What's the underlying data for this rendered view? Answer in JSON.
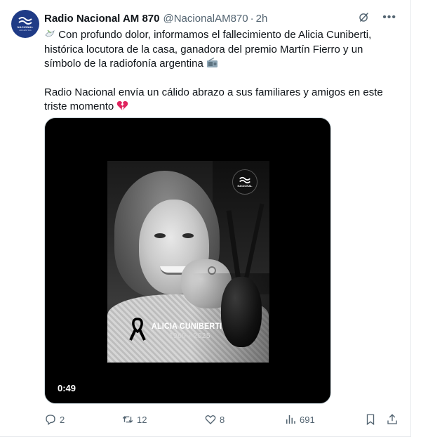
{
  "post": {
    "author_name": "Radio Nacional AM 870",
    "handle": "@NacionalAM870",
    "separator": "·",
    "time": "2h",
    "avatar_text": "NACIONAL",
    "avatar_sub": "ARGENTINA",
    "paragraph1": " Con profundo dolor, informamos el fallecimiento de Alicia Cuniberti, histórica locutora de la casa, ganadora del premio Martín Fierro y un símbolo de la radiofonía argentina ",
    "paragraph2": "Radio Nacional envía un cálido abrazo a sus familiares y amigos en este triste momento "
  },
  "media": {
    "logo_text": "NACIONAL",
    "overlay_name": "ALICIA CUNIBERTI",
    "overlay_years": "1960 - 2025",
    "duration": "0:49"
  },
  "engagement": {
    "replies": "2",
    "reposts": "12",
    "likes": "8",
    "views": "691"
  },
  "colors": {
    "text": "#0f1419",
    "secondary": "#536471",
    "brand_avatar": "#1f3b86",
    "media_bg": "#000000"
  }
}
